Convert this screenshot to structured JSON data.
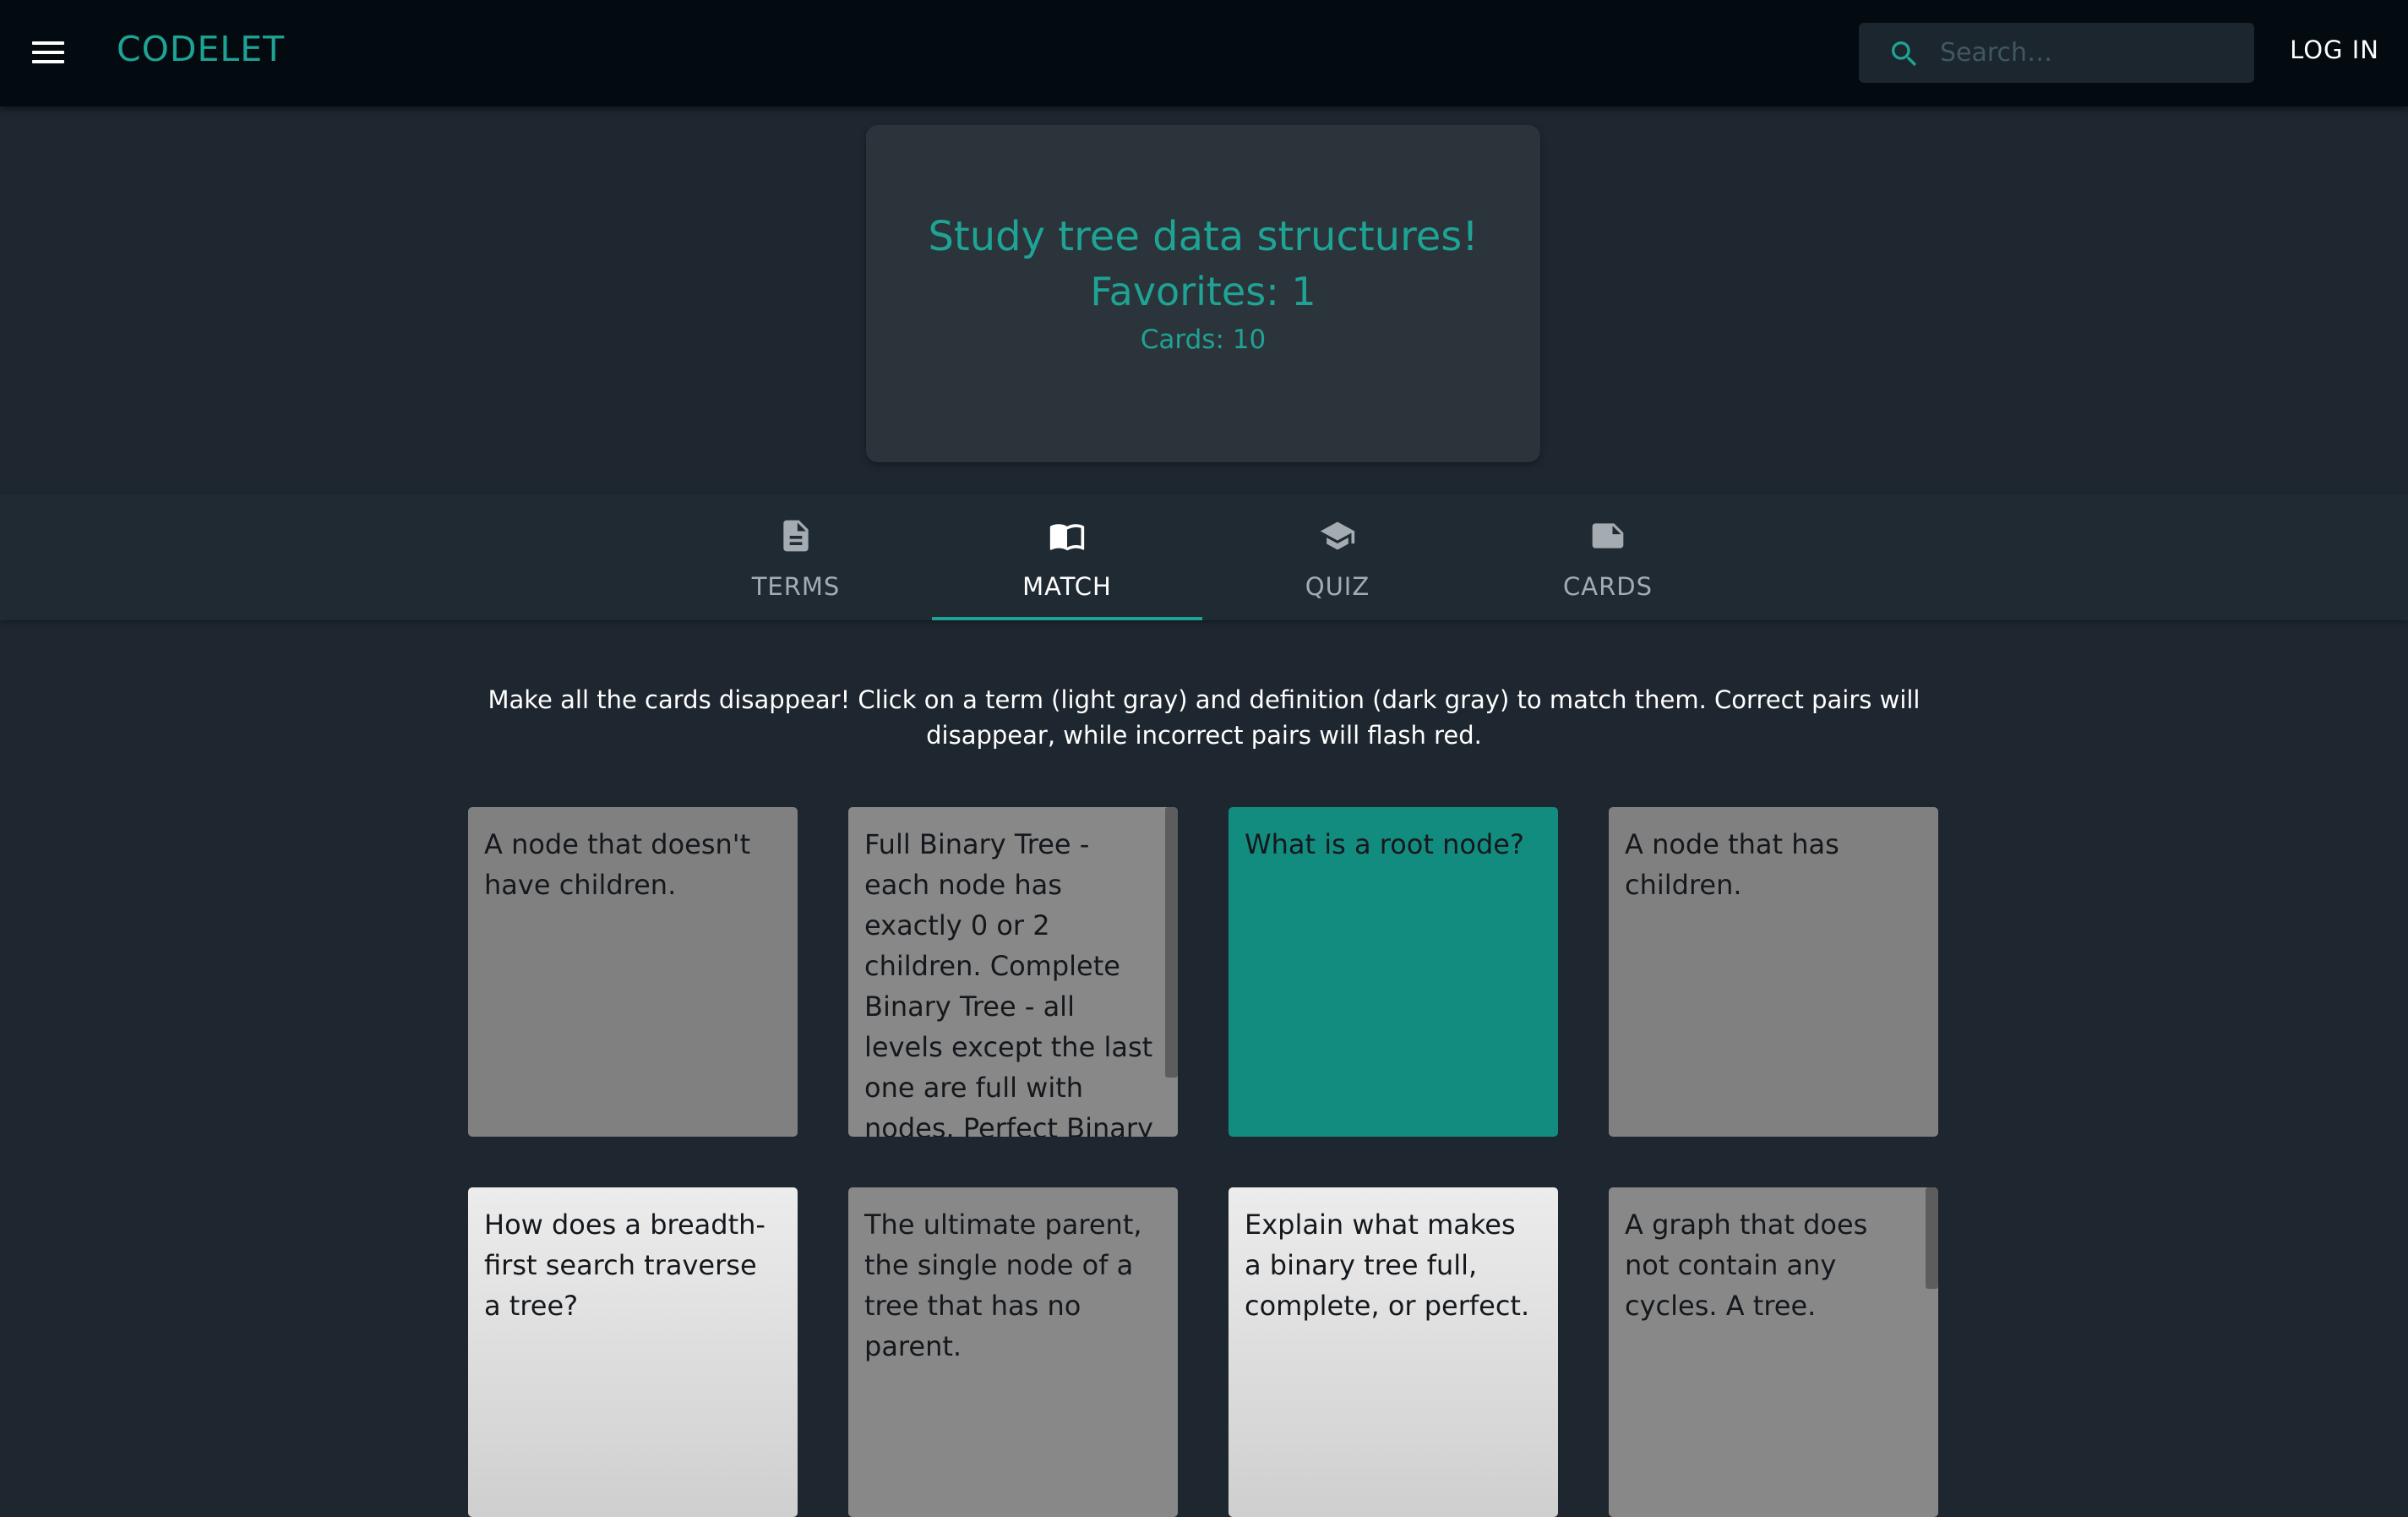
{
  "appbar": {
    "brand": "CODELET",
    "search_placeholder": "Search…",
    "login_label": "LOG IN"
  },
  "set": {
    "title": "Study tree data structures!",
    "favorites": "Favorites: 1",
    "cards": "Cards: 10"
  },
  "tabs": [
    {
      "label": "TERMS",
      "icon": "document-icon",
      "active": false
    },
    {
      "label": "MATCH",
      "icon": "open-book-icon",
      "active": true
    },
    {
      "label": "QUIZ",
      "icon": "graduation-cap-icon",
      "active": false
    },
    {
      "label": "CARDS",
      "icon": "note-card-icon",
      "active": false
    }
  ],
  "instructions": "Make all the cards disappear! Click on a term (light gray) and definition (dark gray) to match them. Correct pairs will disappear, while incorrect pairs will flash red.",
  "cards": [
    {
      "text": "A node that doesn't have children.",
      "kind": "definition"
    },
    {
      "text": "Full Binary Tree - each node has exactly 0 or 2 children. Complete Binary Tree - all levels except the last one are full with nodes. Perfect Binary Tree - all levels (including the last one) are full of nodes.",
      "kind": "definition"
    },
    {
      "text": "What is a root node?",
      "kind": "term",
      "selected": true
    },
    {
      "text": "A node that has children.",
      "kind": "definition"
    },
    {
      "text": "How does a breadth-first search traverse a tree?",
      "kind": "term"
    },
    {
      "text": "The ultimate parent, the single node of a tree that has no parent.",
      "kind": "definition"
    },
    {
      "text": "Explain what makes a binary tree full, complete, or perfect.",
      "kind": "term"
    },
    {
      "text": "A graph that does not contain any cycles. A tree.",
      "kind": "definition"
    }
  ],
  "colors": {
    "accent": "#1ea394",
    "selected_card": "#138c80",
    "definition_card": "#808080",
    "term_card": "#dcdcdc",
    "background": "#1e2730",
    "appbar": "#030a10"
  }
}
